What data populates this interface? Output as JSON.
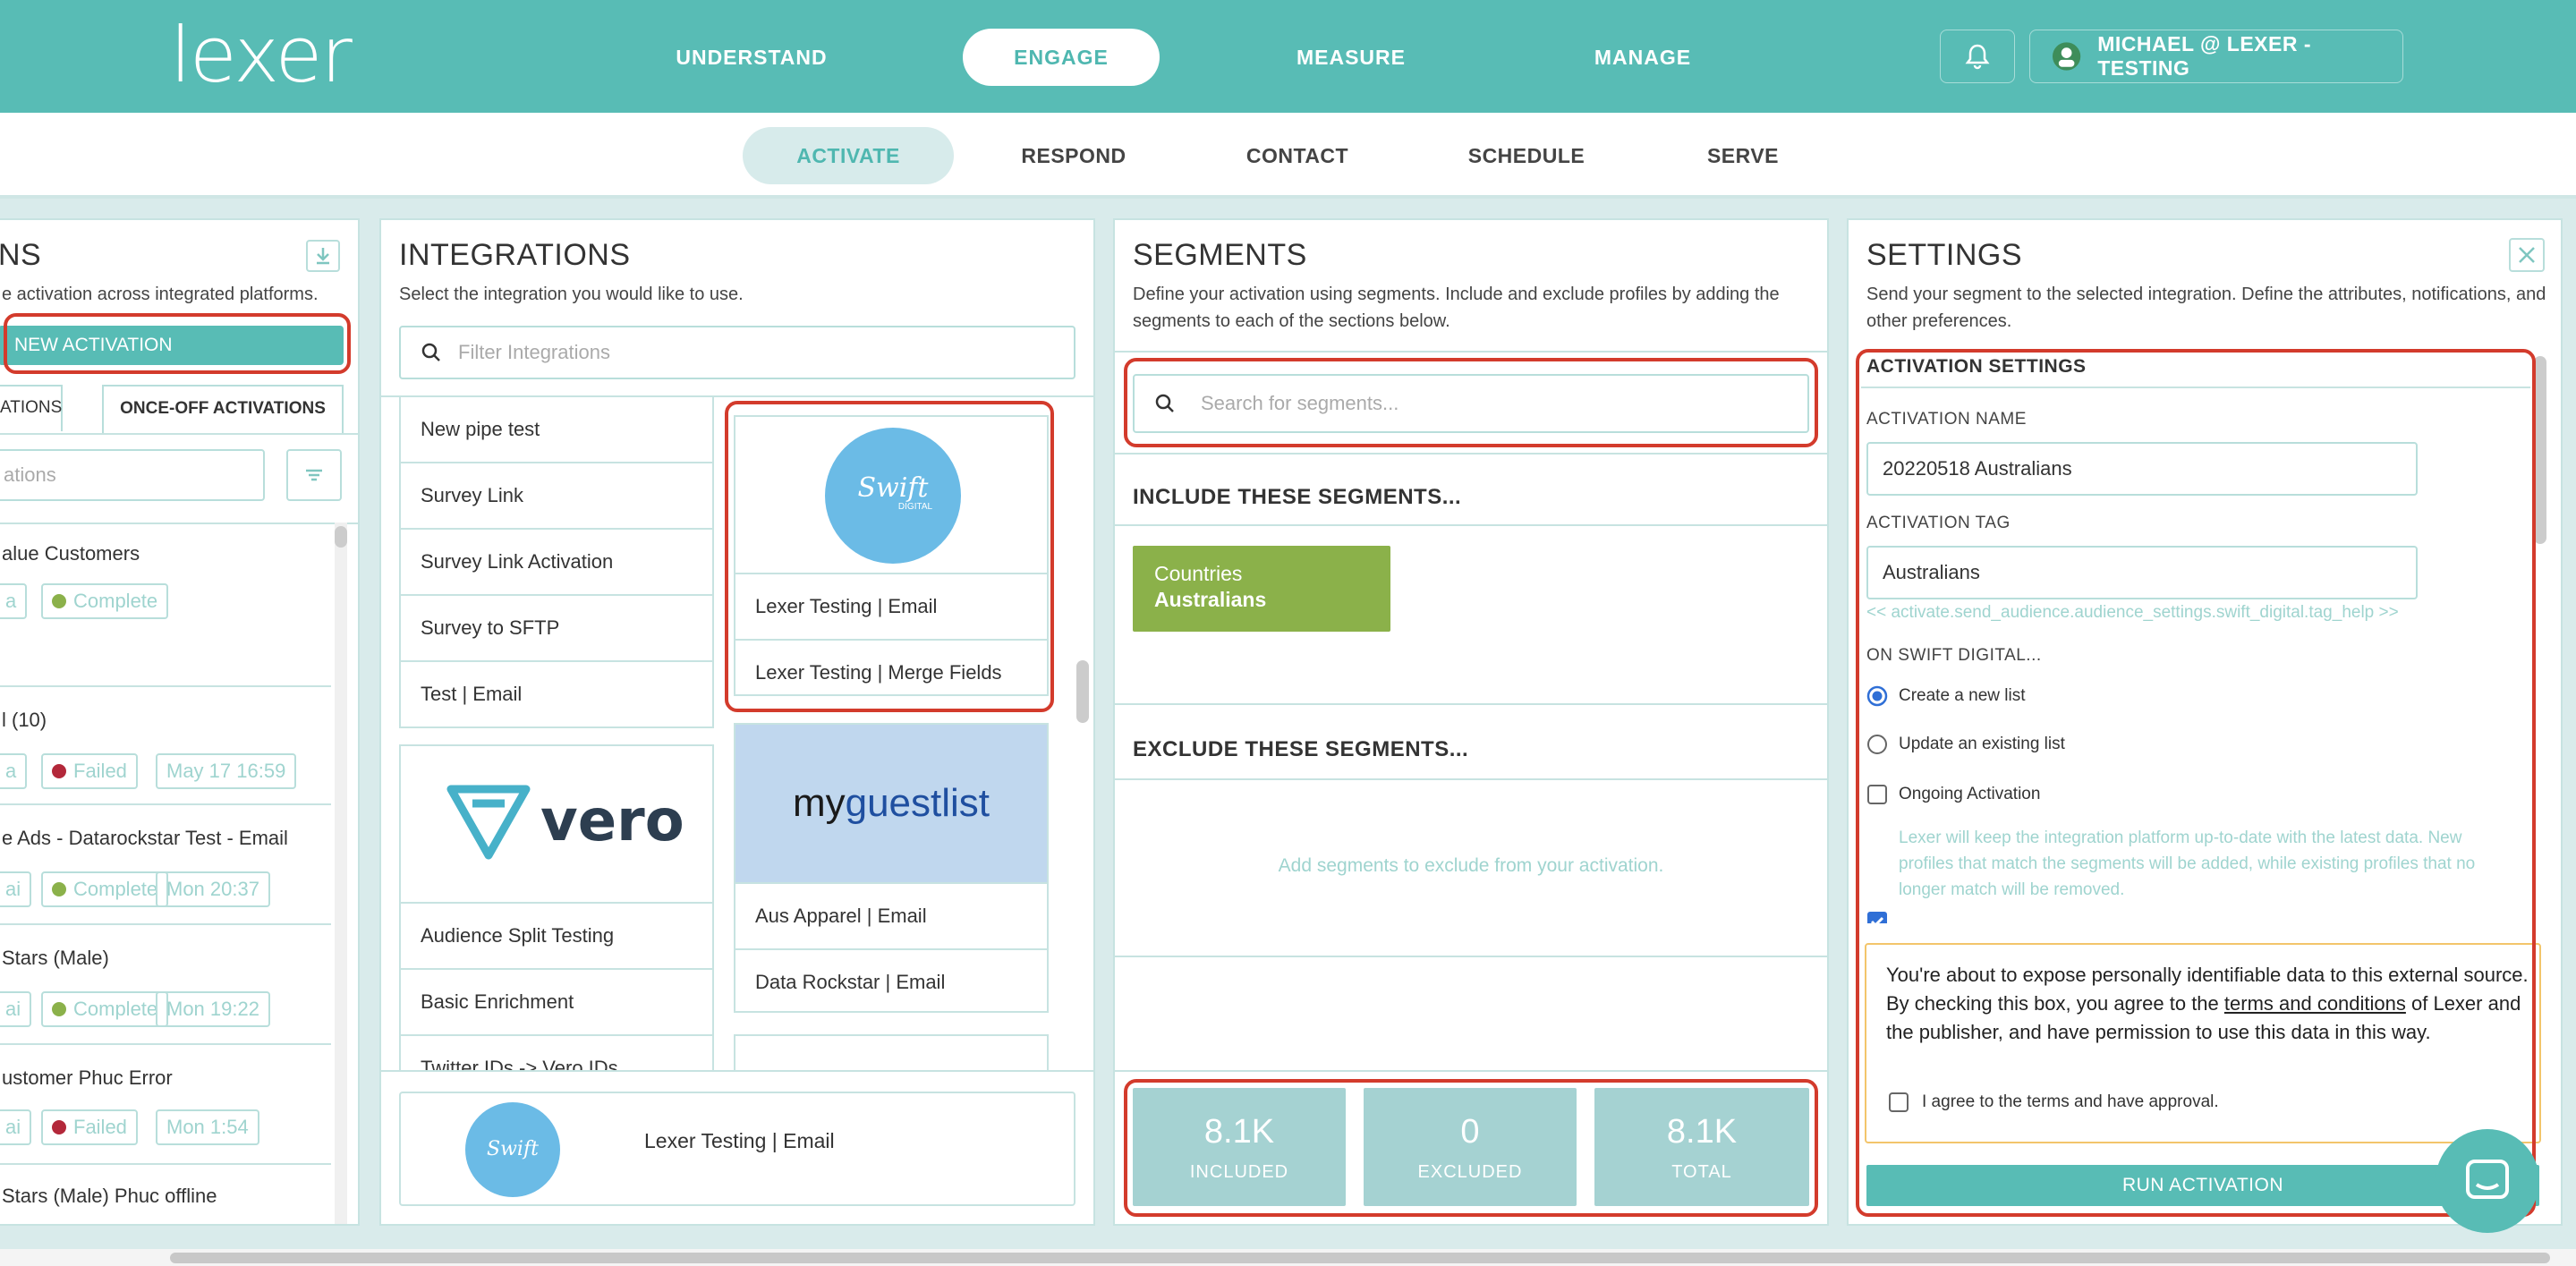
{
  "header": {
    "logo": "lexer",
    "nav": [
      "UNDERSTAND",
      "ENGAGE",
      "MEASURE",
      "MANAGE"
    ],
    "active_nav": "ENGAGE",
    "user": "MICHAEL @ LEXER - TESTING"
  },
  "subnav": {
    "items": [
      "ACTIVATE",
      "RESPOND",
      "CONTACT",
      "SCHEDULE",
      "SERVE"
    ],
    "active": "ACTIVATE"
  },
  "activations_panel": {
    "title": "NS",
    "desc": "e activation across integrated platforms.",
    "new_button": "NEW ACTIVATION",
    "tabs": [
      "ATIONS",
      "ONCE-OFF ACTIVATIONS"
    ],
    "search_placeholder": "ations",
    "items": [
      {
        "name": "alue Customers",
        "prefix": "a",
        "status": "Complete",
        "date": ""
      },
      {
        "name": "l (10)",
        "prefix": "a",
        "status": "Failed",
        "date": "May 17 16:59"
      },
      {
        "name": "e Ads - Datarockstar Test - Email",
        "prefix": "ai",
        "status": "Complete",
        "date": "Mon 20:37"
      },
      {
        "name": "Stars (Male)",
        "prefix": "ai",
        "status": "Complete",
        "date": "Mon 19:22"
      },
      {
        "name": "ustomer Phuc Error",
        "prefix": "ai",
        "status": "Failed",
        "date": "Mon 1:54"
      },
      {
        "name": "Stars (Male) Phuc offline",
        "prefix": "",
        "status": "",
        "date": ""
      }
    ]
  },
  "integrations_panel": {
    "title": "INTEGRATIONS",
    "desc": "Select the integration you would like to use.",
    "search_placeholder": "Filter Integrations",
    "list_left": [
      "New pipe test",
      "Survey Link",
      "Survey Link Activation",
      "Survey to SFTP",
      "Test | Email"
    ],
    "swift_card": {
      "logo_text": "Swift",
      "logo_sub": "DIGITAL",
      "rows": [
        "Lexer Testing | Email",
        "Lexer Testing | Merge Fields"
      ]
    },
    "vero_card": {
      "logo_text": "vero",
      "rows": [
        "Audience Split Testing",
        "Basic Enrichment",
        "Twitter IDs -> Vero IDs"
      ]
    },
    "myguestlist_card": {
      "logo_text_a": "my",
      "logo_text_b": "guestlist",
      "rows": [
        "Aus Apparel | Email",
        "Data Rockstar | Email"
      ]
    },
    "selected": "Lexer Testing | Email"
  },
  "segments_panel": {
    "title": "SEGMENTS",
    "desc": "Define your activation using segments. Include and exclude profiles by adding the segments to each of the sections below.",
    "search_placeholder": "Search for segments...",
    "include_head": "INCLUDE THESE SEGMENTS...",
    "include_chip": {
      "category": "Countries",
      "value": "Australians"
    },
    "exclude_head": "EXCLUDE THESE SEGMENTS...",
    "exclude_empty": "Add segments to exclude from your activation.",
    "stats": [
      {
        "value": "8.1K",
        "label": "INCLUDED"
      },
      {
        "value": "0",
        "label": "EXCLUDED"
      },
      {
        "value": "8.1K",
        "label": "TOTAL"
      }
    ]
  },
  "settings_panel": {
    "title": "SETTINGS",
    "desc": "Send your segment to the selected integration. Define the attributes, notifications, and other preferences.",
    "section": "ACTIVATION SETTINGS",
    "name_label": "ACTIVATION NAME",
    "name_value": "20220518 Australians",
    "tag_label": "ACTIVATION TAG",
    "tag_value": "Australians",
    "tag_help": "<< activate.send_audience.audience_settings.swift_digital.tag_help >>",
    "on_label": "ON SWIFT DIGITAL...",
    "radio_create": "Create a new list",
    "radio_update": "Update an existing list",
    "ongoing_label": "Ongoing Activation",
    "ongoing_help": "Lexer will keep the integration platform up-to-date with the latest data. New profiles that match the segments will be added, while existing profiles that no longer match will be removed.",
    "warning_a": "You're about to expose personally identifiable data to this external source. By checking this box, you agree to the ",
    "warning_link": "terms and conditions",
    "warning_b": " of Lexer and the publisher, and have permission to use this data in this way.",
    "agree_label": "I agree to the terms and have approval.",
    "run_button": "RUN ACTIVATION"
  },
  "colors": {
    "teal": "#58bcb5",
    "green_chip": "#8bb14a",
    "stat_bg": "#a5d2d2",
    "red_annot": "#d33b2c",
    "warning_border": "#f3c56b"
  }
}
